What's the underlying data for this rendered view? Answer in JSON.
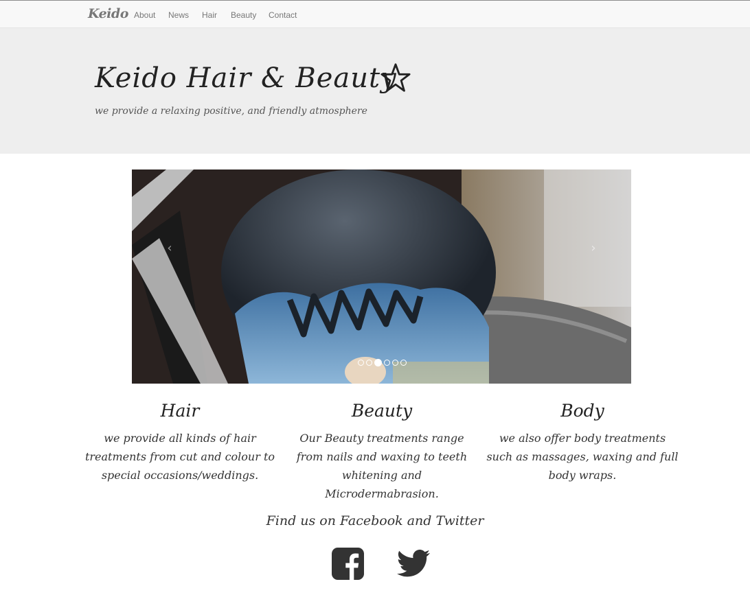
{
  "navbar": {
    "brand": "Keido",
    "links": [
      "About",
      "News",
      "Hair",
      "Beauty",
      "Contact"
    ]
  },
  "jumbotron": {
    "title": "Keido Hair & Beauty",
    "subtitle": "we provide a relaxing positive, and friendly atmosphere",
    "icon": "star-outline-icon"
  },
  "carousel": {
    "prev_label": "‹",
    "next_label": "›",
    "slide_count": 6,
    "active_index": 2
  },
  "features": [
    {
      "title": "Hair",
      "text": "we provide all kinds of hair treatments from cut and colour to special occasions/weddings."
    },
    {
      "title": "Beauty",
      "text": "Our Beauty treatments range from nails and waxing to teeth whitening and Microdermabrasion."
    },
    {
      "title": "Body",
      "text": "we also offer body treatments such as massages, waxing and full body wraps."
    }
  ],
  "social": {
    "heading": "Find us on Facebook and Twitter",
    "icons": [
      "facebook-icon",
      "twitter-icon"
    ]
  },
  "colors": {
    "jumbotron_bg": "#eeeeee",
    "navbar_bg": "#f8f8f8",
    "icon_color": "#333333"
  }
}
